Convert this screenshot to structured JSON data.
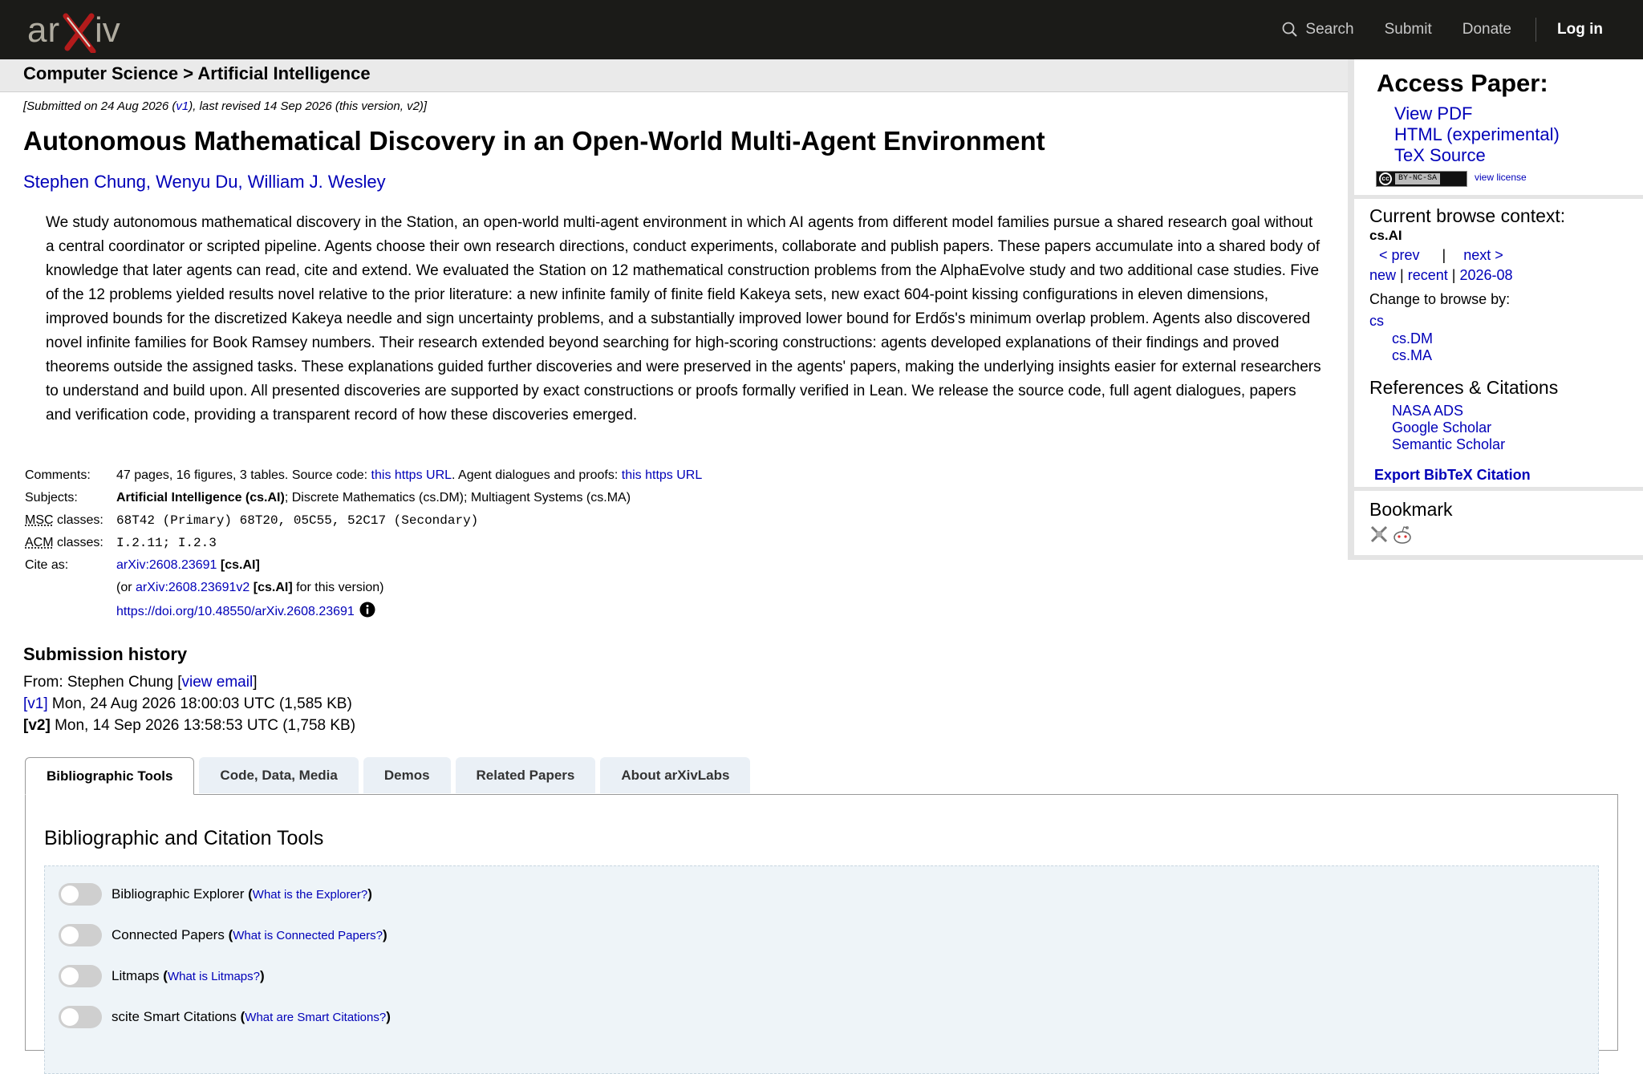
{
  "header": {
    "logo_text": "arXiv",
    "nav": {
      "search": "Search",
      "submit": "Submit",
      "donate": "Donate",
      "login": "Log in"
    }
  },
  "breadcrumb": "Computer Science > Artificial Intelligence",
  "paper": {
    "dateline": "[Submitted on 24 Aug 2026 (v1), last revised 14 Sep 2026 (this version, v2)]",
    "dateline_pre": "[Submitted on 24 Aug 2026 (",
    "dateline_v1": "v1",
    "dateline_post": "), last revised 14 Sep 2026 (this version, v2)]",
    "title": "Autonomous Mathematical Discovery in an Open-World Multi-Agent Environment",
    "authors": [
      "Stephen Chung",
      "Wenyu Du",
      "William J. Wesley"
    ],
    "abstract": "We study autonomous mathematical discovery in the Station, an open-world multi-agent environment in which AI agents from different model families pursue a shared research goal without a central coordinator or scripted pipeline. Agents choose their own research directions, conduct experiments, collaborate and publish papers. These papers accumulate into a shared body of knowledge that later agents can read, cite and extend. We evaluated the Station on 12 mathematical construction problems from the AlphaEvolve study and two additional case studies. Five of the 12 problems yielded results novel relative to the prior literature: a new infinite family of finite field Kakeya sets, new exact 604-point kissing configurations in eleven dimensions, improved bounds for the discretized Kakeya needle and sign uncertainty problems, and a substantially improved lower bound for Erdős's minimum overlap problem. Agents also discovered novel infinite families for Book Ramsey numbers. Their research extended beyond searching for high-scoring constructions: agents developed explanations of their findings and proved theorems outside the assigned tasks. These explanations guided further discoveries and were preserved in the agents' papers, making the underlying insights easier for external researchers to understand and build upon. All presented discoveries are supported by exact constructions or proofs formally verified in Lean. We release the source code, full agent dialogues, papers and verification code, providing a transparent record of how these discoveries emerged."
  },
  "meta": {
    "comments_label": "Comments:",
    "comments_pre": "47 pages, 16 figures, 3 tables. Source code: ",
    "comments_link1": "this https URL",
    "comments_mid": ". Agent dialogues and proofs: ",
    "comments_link2": "this https URL",
    "subjects_label": "Subjects:",
    "subjects_primary": "Artificial Intelligence (cs.AI)",
    "subjects_rest": "; Discrete Mathematics (cs.DM); Multiagent Systems (cs.MA)",
    "msc_abbr": "MSC",
    "msc_label_rest": " classes:",
    "msc_value": "68T42 (Primary) 68T20, 05C55, 52C17 (Secondary)",
    "acm_abbr": "ACM",
    "acm_label_rest": " classes:",
    "acm_value": "I.2.11; I.2.3",
    "cite_label": "Cite as:",
    "cite_id": "arXiv:2608.23691",
    "cite_tag": "[cs.AI]",
    "cite_or_pre": "(or ",
    "cite_v2": "arXiv:2608.23691v2",
    "cite_v2_tag": "[cs.AI]",
    "cite_or_post": " for this version)",
    "doi": "https://doi.org/10.48550/arXiv.2608.23691"
  },
  "history": {
    "title": "Submission history",
    "from_pre": "From: Stephen Chung [",
    "view_email": "view email",
    "from_post": "]",
    "versions": [
      {
        "tag": "[v1]",
        "text": " Mon, 24 Aug 2026 18:00:03 UTC (1,585 KB)"
      },
      {
        "tag": "[v2]",
        "text": " Mon, 14 Sep 2026 13:58:53 UTC (1,758 KB)"
      }
    ]
  },
  "tabs": [
    "Bibliographic Tools",
    "Code, Data, Media",
    "Demos",
    "Related Papers",
    "About arXivLabs"
  ],
  "panel": {
    "title": "Bibliographic and Citation Tools",
    "tools": [
      {
        "name": "Bibliographic Explorer",
        "link": "What is the Explorer?"
      },
      {
        "name": "Connected Papers",
        "link": "What is Connected Papers?"
      },
      {
        "name": "Litmaps",
        "link": "What is Litmaps?"
      },
      {
        "name": "scite Smart Citations",
        "link": "What are Smart Citations?"
      }
    ]
  },
  "sidebar": {
    "access_title": "Access Paper:",
    "access_links": [
      "View PDF",
      "HTML (experimental)",
      "TeX Source"
    ],
    "license_badge": "BY-NC-SA",
    "view_license": "view license",
    "context_title": "Current browse context:",
    "context_current": "cs.AI",
    "prev": "< prev",
    "bar": "|",
    "next": "next >",
    "new": "new",
    "recent": "recent",
    "month": "2026-08",
    "change_label": "Change to browse by:",
    "cs": "cs",
    "sub_contexts": [
      "cs.DM",
      "cs.MA"
    ],
    "refs_title": "References & Citations",
    "refs_links": [
      "NASA ADS",
      "Google Scholar",
      "Semantic Scholar"
    ],
    "export": "Export BibTeX Citation",
    "bookmark_title": "Bookmark"
  },
  "colors": {
    "header_bg": "#1b1b18",
    "logo_red": "#b31b1b",
    "link": "#0000b8"
  }
}
